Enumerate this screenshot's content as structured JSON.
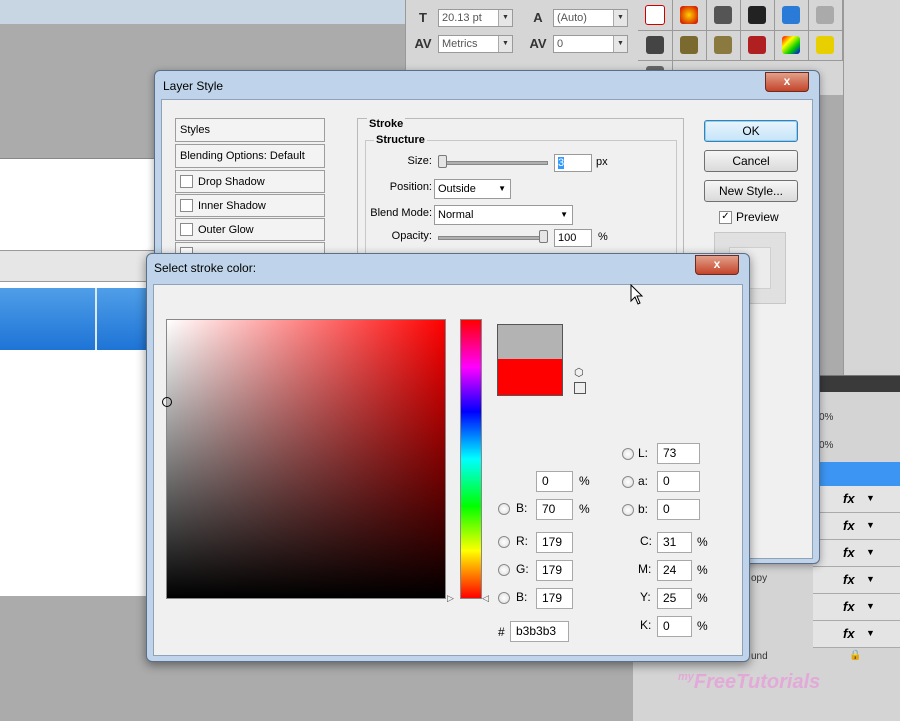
{
  "character_panel": {
    "font_size": "20.13 pt",
    "leading": "(Auto)",
    "kerning": "Metrics",
    "tracking": "0"
  },
  "layer_style": {
    "title": "Layer Style",
    "close_glyph": "x",
    "list": {
      "styles": "Styles",
      "blending": "Blending Options: Default",
      "items": [
        "Drop Shadow",
        "Inner Shadow",
        "Outer Glow"
      ]
    },
    "stroke": {
      "title": "Stroke",
      "structure_title": "Structure",
      "size_label": "Size:",
      "size_value": "3",
      "size_unit": "px",
      "position_label": "Position:",
      "position_value": "Outside",
      "blend_label": "Blend Mode:",
      "blend_value": "Normal",
      "opacity_label": "Opacity:",
      "opacity_value": "100",
      "opacity_unit": "%"
    },
    "buttons": {
      "ok": "OK",
      "cancel": "Cancel",
      "new_style": "New Style...",
      "preview": "Preview"
    }
  },
  "color_picker": {
    "title": "Select stroke color:",
    "close_glyph": "x",
    "hue_color": "#ff0000",
    "new_color": "#b3b3b3",
    "current_color": "#ff0000",
    "hsb": {
      "s_value": "0",
      "s_unit": "%",
      "b_label": "B:",
      "b_value": "70",
      "b_unit": "%"
    },
    "rgb": {
      "r_label": "R:",
      "r_value": "179",
      "g_label": "G:",
      "g_value": "179",
      "b_label": "B:",
      "b_value": "179"
    },
    "lab": {
      "l_label": "L:",
      "l_value": "73",
      "a_label": "a:",
      "a_value": "0",
      "b_label": "b:",
      "b_value": "0"
    },
    "cmyk": {
      "c_label": "C:",
      "c_value": "31",
      "m_label": "M:",
      "m_value": "24",
      "y_label": "Y:",
      "y_value": "25",
      "k_label": "K:",
      "k_value": "0",
      "unit": "%"
    },
    "hex_label": "#",
    "hex_value": "b3b3b3"
  },
  "layers_panel": {
    "fx_label": "fx",
    "opacity_snippet": "0%",
    "partial_copy": "opy",
    "partial_background": "und"
  },
  "watermark": {
    "my": "my",
    "brand": "FreeTutorials"
  },
  "icons": [
    "text-size-icon",
    "leading-icon",
    "kerning-icon",
    "tracking-icon",
    "lock-icon",
    "cube-icon",
    "cursor-icon"
  ]
}
